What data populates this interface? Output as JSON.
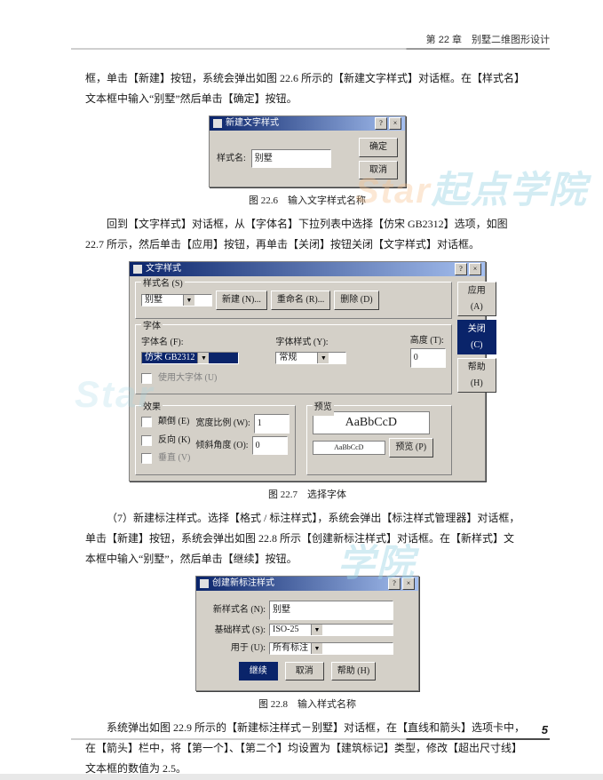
{
  "header": {
    "chapter_label": "第 22 章　别墅二维图形设计"
  },
  "paragraphs": {
    "p1a": "框，单击【新建】按钮，系统会弹出如图 22.6 所示的【新建文字样式】对话框。在【样式名】",
    "p1b": "文本框中输入“别墅”然后单击【确定】按钮。",
    "p2a": "回到【文字样式】对话框，从【字体名】下拉列表中选择【仿宋 GB2312】选项，如图",
    "p2b": "22.7 所示，然后单击【应用】按钮，再单击【关闭】按钮关闭【文字样式】对话框。",
    "p3a": "（7）新建标注样式。选择【格式 / 标注样式】，系统会弹出【标注样式管理器】对话框，",
    "p3b": "单击【新建】按钮，系统会弹出如图 22.8 所示【创建新标注样式】对话框。在【新样式】文",
    "p3c": "本框中输入“别墅”，然后单击【继续】按钮。",
    "p4a": "系统弹出如图 22.9 所示的【新建标注样式－别墅】对话框，在【直线和箭头】选项卡中，",
    "p4b": "在【箭头】栏中，将【第一个】、【第二个】均设置为【建筑标记】类型，修改【超出尺寸线】",
    "p4c": "文本框的数值为 2.5。"
  },
  "captions": {
    "c226": "图 22.6　输入文字样式名称",
    "c227": "图 22.7　选择字体",
    "c228": "图 22.8　输入样式名称"
  },
  "dlg226": {
    "title": "新建文字样式",
    "label": "样式名:",
    "value": "别墅",
    "ok": "确定",
    "cancel": "取消"
  },
  "dlg227": {
    "title": "文字样式",
    "group_name": "样式名 (S)",
    "style_value": "别墅",
    "btn_new": "新建 (N)...",
    "btn_rename": "重命名 (R)...",
    "btn_delete": "删除 (D)",
    "btn_apply": "应用 (A)",
    "btn_close": "关闭 (C)",
    "btn_help": "帮助 (H)",
    "group_font": "字体",
    "font_label": "字体名 (F):",
    "font_value": "仿宋 GB2312",
    "font_style_label": "字体样式 (Y):",
    "font_style_value": "常规",
    "height_label": "高度 (T):",
    "height_value": "0",
    "bigfont_chk": "使用大字体 (U)",
    "group_effect": "效果",
    "upside": "颠倒 (E)",
    "reverse": "反向 (K)",
    "vertical": "垂直 (V)",
    "width_label": "宽度比例 (W):",
    "width_value": "1",
    "oblique_label": "倾斜角度 (O):",
    "oblique_value": "0",
    "group_preview": "预览",
    "preview_text": "AaBbCcD",
    "preview_small": "AaBbCcD",
    "btn_preview": "预览 (P)"
  },
  "dlg228": {
    "title": "创建新标注样式",
    "name_label": "新样式名 (N):",
    "name_value": "别墅",
    "base_label": "基础样式 (S):",
    "base_value": "ISO-25",
    "use_label": "用于 (U):",
    "use_value": "所有标注",
    "btn_continue": "继续",
    "btn_cancel": "取消",
    "btn_help": "帮助 (H)"
  },
  "footer": {
    "page_num": "5"
  }
}
